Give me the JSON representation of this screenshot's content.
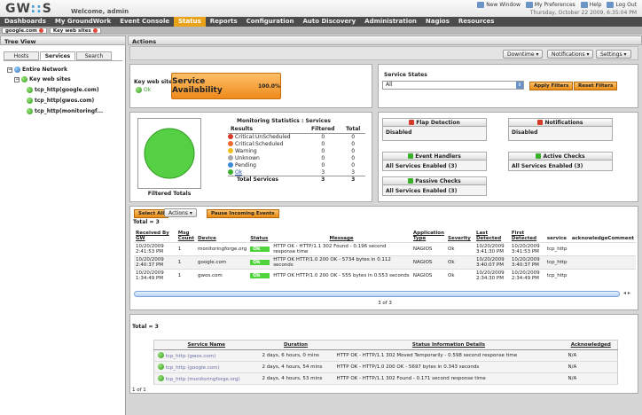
{
  "header": {
    "logo_a": "GW",
    "logo_b": "::",
    "logo_c": "S",
    "welcome": "Welcome, admin",
    "links": [
      "New Window",
      "My Preferences",
      "Help",
      "Log Out"
    ],
    "date": "Thursday, October 22 2009, 6:35:04 PM"
  },
  "nav": [
    "Dashboards",
    "My GroundWork",
    "Event Console",
    "Status",
    "Reports",
    "Configuration",
    "Auto Discovery",
    "Administration",
    "Nagios",
    "Resources"
  ],
  "subnav": [
    "google.com",
    "Key web sites"
  ],
  "tree_view": {
    "title": "Tree View",
    "tabs": [
      "Hosts",
      "Services",
      "Search"
    ],
    "items": [
      "Entire Network",
      "Key web sites",
      "tcp_http(google.com)",
      "tcp_http(gwos.com)",
      "tcp_http(monitoringf..."
    ]
  },
  "actions": {
    "title": "Actions",
    "buttons": [
      "Downtime",
      "Notifications",
      "Settings"
    ]
  },
  "group": {
    "name": "Key web sites",
    "status": "Ok",
    "availability_label": "Service Availability",
    "availability_value": "100.0%"
  },
  "service_states": {
    "label": "Service States",
    "select_value": "All",
    "apply": "Apply Filters",
    "reset": "Reset Filters"
  },
  "stats": {
    "title": "Monitoring Statistics : Services",
    "caption": "Filtered Totals",
    "headers": [
      "Results",
      "Filtered",
      "Total"
    ],
    "rows": [
      {
        "label": "Critical:UnScheduled",
        "f": "0",
        "t": "0",
        "color": "#d83a2a"
      },
      {
        "label": "Critical:Scheduled",
        "f": "0",
        "t": "0",
        "color": "#e86a2a"
      },
      {
        "label": "Warning",
        "f": "0",
        "t": "0",
        "color": "#f0c020"
      },
      {
        "label": "Unknown",
        "f": "0",
        "t": "0",
        "color": "#aaaaaa"
      },
      {
        "label": "Pending",
        "f": "0",
        "t": "0",
        "color": "#3a8ad8"
      },
      {
        "label": "Ok",
        "f": "3",
        "t": "3",
        "color": "#3ab02a"
      }
    ],
    "total_label": "Total Services",
    "total_f": "3",
    "total_t": "3"
  },
  "checks": {
    "flap": "Flap Detection",
    "flap_v": "Disabled",
    "notif": "Notifications",
    "notif_v": "Disabled",
    "handlers": "Event Handlers",
    "handlers_v": "All Services Enabled (3)",
    "active": "Active Checks",
    "active_v": "All Services Enabled (3)",
    "passive": "Passive Checks",
    "passive_v": "All Services Enabled (3)"
  },
  "events": {
    "select_all": "Select All",
    "actions": "Actions",
    "pause": "Pause Incoming Events",
    "total": "Total = 3",
    "pager": "3 of 3",
    "headers": [
      "Received By GW",
      "Msg Count",
      "Device",
      "Status",
      "Message",
      "Application Type",
      "Severity",
      "Last Detected",
      "First Detected",
      "service",
      "acknowledgeComment"
    ],
    "rows": [
      [
        "10/20/2009 2:41:53 PM",
        "1",
        "monitoringforge.org",
        "Ok",
        "HTTP OK - HTTP/1.1 302 Found - 0.196 second response time",
        "NAGIOS",
        "Ok",
        "10/20/2009 3:41:30 PM",
        "10/20/2009 3:41:53 PM",
        "tcp_http"
      ],
      [
        "10/20/2009 2:40:37 PM",
        "1",
        "google.com",
        "Ok",
        "HTTP OK HTTP/1.0 200 OK - 5734 bytes in 0.112 seconds",
        "NAGIOS",
        "Ok",
        "10/20/2009 3:40:07 PM",
        "10/20/2009 3:40:37 PM",
        "tcp_http"
      ],
      [
        "10/20/2009 1:34:49 PM",
        "1",
        "gwos.com",
        "Ok",
        "HTTP OK HTTP/1.0 200 OK - 555 bytes in 0.553 seconds",
        "NAGIOS",
        "Ok",
        "10/20/2009 2:34:30 PM",
        "10/20/2009 2:34:49 PM",
        "tcp_http"
      ]
    ]
  },
  "services": {
    "total": "Total = 3",
    "footer": "1 of 1",
    "headers": [
      "Service Name",
      "Duration",
      "Status Information Details",
      "Acknowledged"
    ],
    "rows": [
      [
        "tcp_http (gwos.com)",
        "2 days, 6 hours, 0 mins",
        "HTTP OK - HTTP/1.1 302 Moved Temporarily - 0.598 second response time",
        "N/A"
      ],
      [
        "tcp_http (google.com)",
        "2 days, 4 hours, 54 mins",
        "HTTP OK - HTTP/1.0 200 OK - 5697 bytes in 0.343 seconds",
        "N/A"
      ],
      [
        "tcp_http (monitoringforge.org)",
        "2 days, 4 hours, 53 mins",
        "HTTP OK - HTTP/1.1 302 Found - 0.171 second response time",
        "N/A"
      ]
    ]
  }
}
